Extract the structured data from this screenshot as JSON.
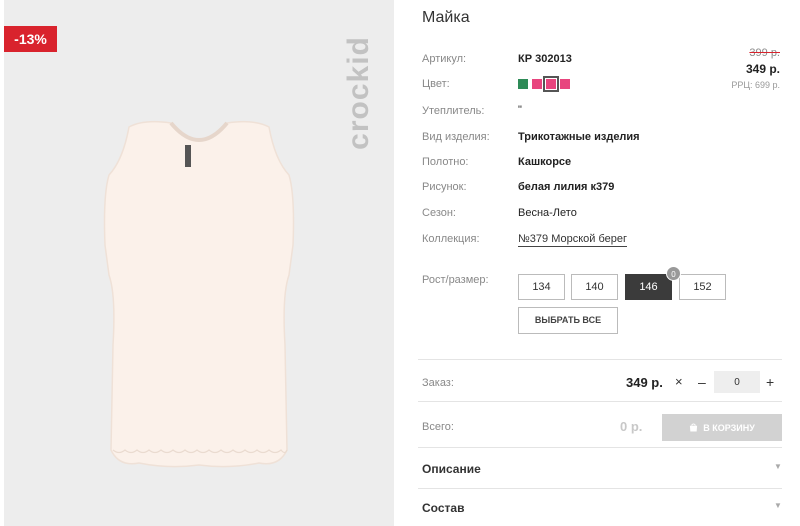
{
  "product": {
    "title": "Майка",
    "discount_badge": "-13%",
    "brand_logo_text": "crockid",
    "specs": [
      {
        "label": "Артикул:",
        "value": "КР 302013"
      },
      {
        "label": "Цвет:",
        "value": ""
      },
      {
        "label": "Утеплитель:",
        "value": "\""
      },
      {
        "label": "Вид изделия:",
        "value": "Трикотажные изделия"
      },
      {
        "label": "Полотно:",
        "value": "Кашкорсе"
      },
      {
        "label": "Рисунок:",
        "value": "белая лилия к379"
      },
      {
        "label": "Сезон:",
        "value": "Весна-Лето"
      },
      {
        "label": "Коллекция:",
        "value": "№379 Морской берег"
      }
    ],
    "colors": [
      "#2e8b57",
      "#e8457e",
      "#e8457e",
      "#e8457e"
    ],
    "selected_color_index": 2
  },
  "price": {
    "old": "399 р.",
    "current": "349 р.",
    "rrp": "РРЦ: 699 р."
  },
  "sizes": {
    "label": "Рост/размер:",
    "options": [
      "134",
      "140",
      "146",
      "152"
    ],
    "selected_index": 2,
    "selected_count_badge": "0",
    "select_all_label": "ВЫБРАТЬ ВСЕ"
  },
  "order": {
    "label": "Заказ:",
    "unit_price": "349 р.",
    "times_symbol": "×",
    "minus_symbol": "–",
    "quantity": "0",
    "plus_symbol": "+"
  },
  "total": {
    "label": "Всего:",
    "value": "0 р.",
    "cart_button_label": "В КОРЗИНУ"
  },
  "accordion": [
    {
      "label": "Описание"
    },
    {
      "label": "Состав"
    }
  ]
}
